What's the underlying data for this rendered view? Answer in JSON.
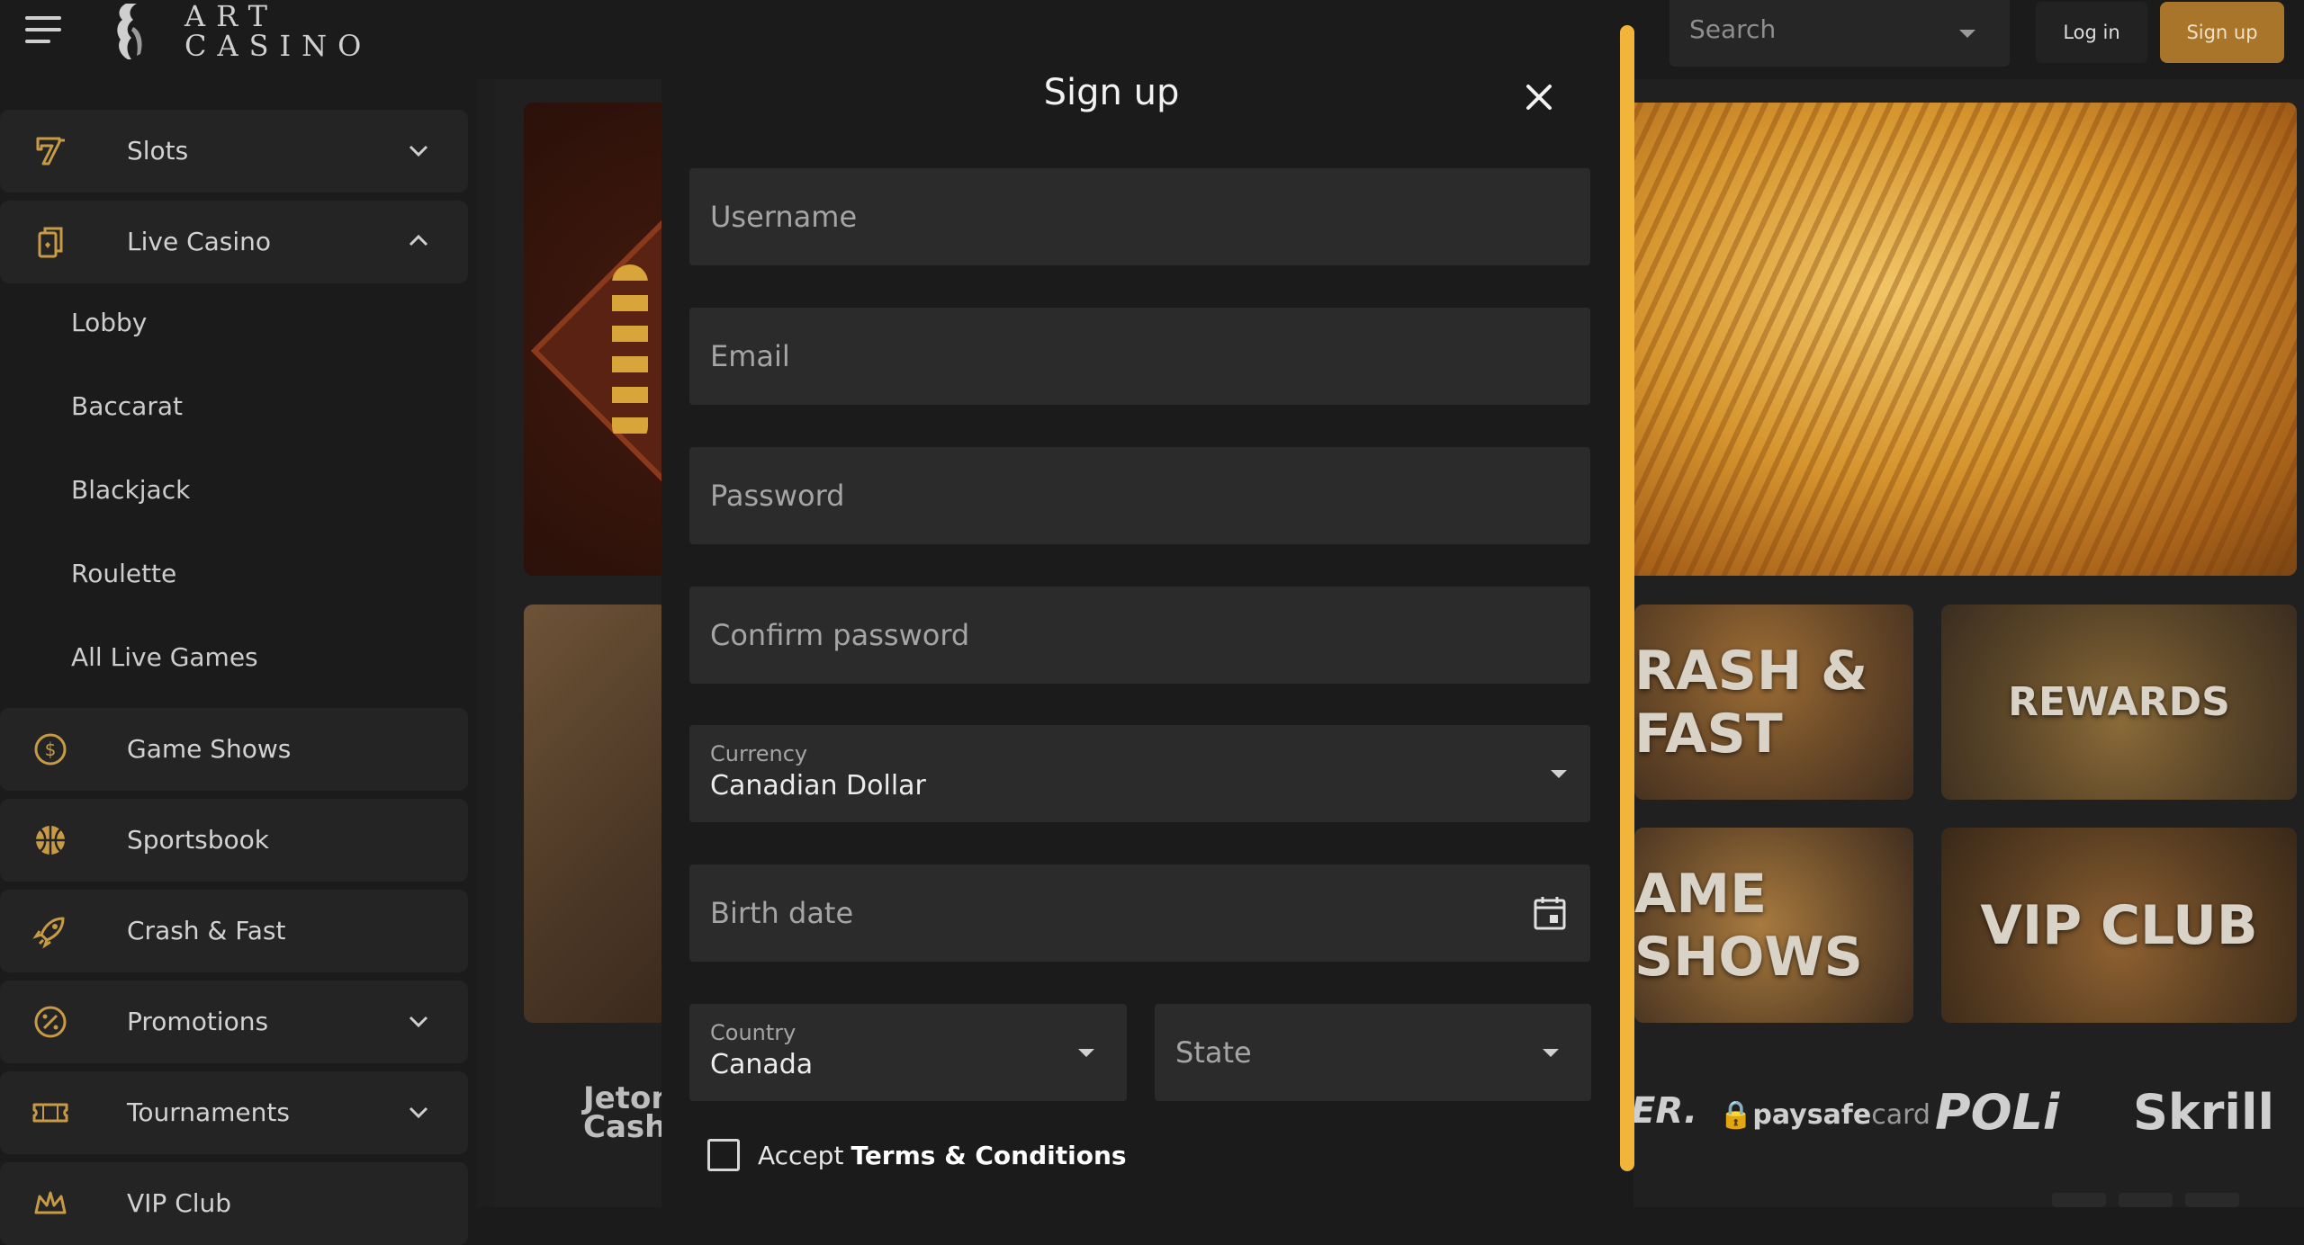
{
  "brand": {
    "logo_line1": "ART",
    "logo_line2": "CASINO"
  },
  "header": {
    "search_placeholder": "Search",
    "login_label": "Log in",
    "signup_label": "Sign up"
  },
  "sidebar": {
    "items": [
      {
        "label": "Slots",
        "icon": "slot-machine-icon",
        "chevron": "down"
      },
      {
        "label": "Live Casino",
        "icon": "cards-icon",
        "chevron": "up"
      },
      {
        "label": "Game Shows",
        "icon": "dollar-coin-icon"
      },
      {
        "label": "Sportsbook",
        "icon": "basketball-icon"
      },
      {
        "label": "Crash & Fast",
        "icon": "rocket-icon"
      },
      {
        "label": "Promotions",
        "icon": "percent-badge-icon",
        "chevron": "down"
      },
      {
        "label": "Tournaments",
        "icon": "ticket-icon",
        "chevron": "down"
      },
      {
        "label": "VIP Club",
        "icon": "crown-icon"
      }
    ],
    "live_casino_sub": [
      "Lobby",
      "Baccarat",
      "Blackjack",
      "Roulette",
      "All Live Games"
    ]
  },
  "background": {
    "tiles": [
      "RASH & FAST",
      "REWARDS",
      "AME SHOWS",
      "VIP CLUB"
    ],
    "payments": {
      "jeton_line1": "Jeton",
      "jeton_line2": "Cash",
      "er": "ER.",
      "paysafe_a": "paysafe",
      "paysafe_b": "card",
      "poli": "POLi",
      "skrill": "Skrill"
    }
  },
  "modal": {
    "title": "Sign up",
    "username_placeholder": "Username",
    "email_placeholder": "Email",
    "password_placeholder": "Password",
    "confirm_password_placeholder": "Confirm password",
    "currency": {
      "label": "Currency",
      "value": "Canadian Dollar"
    },
    "birth_date_placeholder": "Birth date",
    "country": {
      "label": "Country",
      "value": "Canada"
    },
    "state_placeholder": "State",
    "terms_prefix": "Accept",
    "terms_link": "Terms & Conditions"
  },
  "colors": {
    "accent": "#f2b53a",
    "signup_button": "#a9752a",
    "field_bg": "#2b2b2b",
    "page_bg": "#1b1b1b"
  }
}
